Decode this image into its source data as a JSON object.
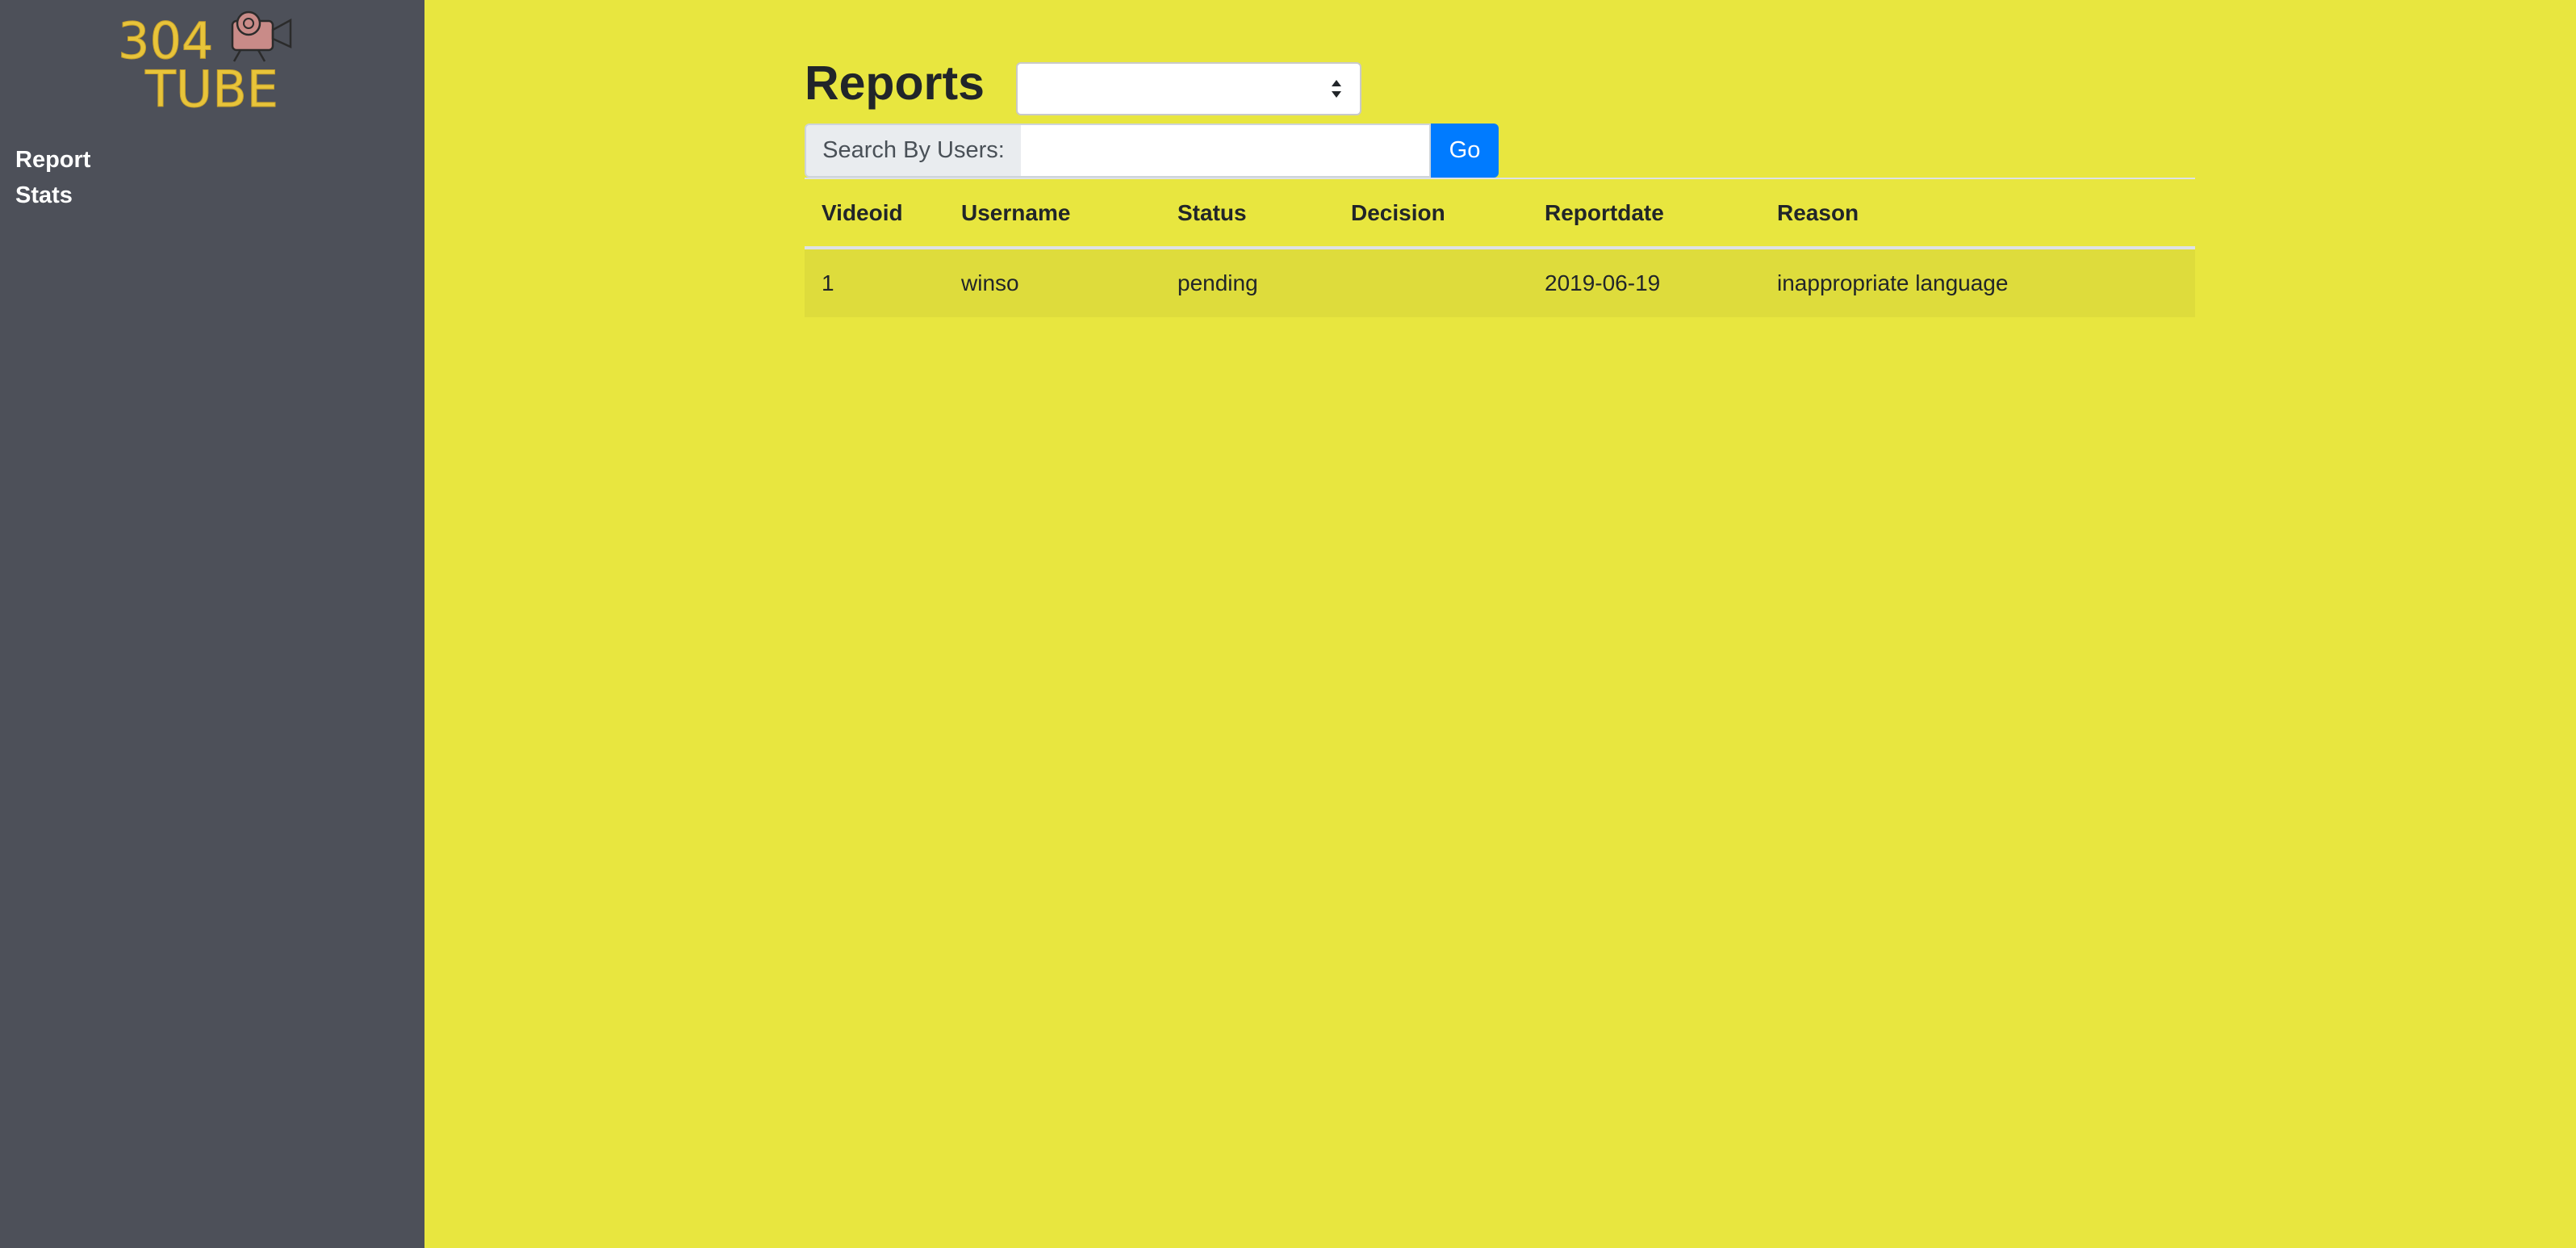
{
  "brand": {
    "logo_alt": "304 TUBE",
    "logo_text_top": "304",
    "logo_text_bottom": "TUBE"
  },
  "sidebar": {
    "items": [
      {
        "label": "Report"
      },
      {
        "label": "Stats"
      }
    ]
  },
  "main": {
    "title": "Reports",
    "filter_select": {
      "value": ""
    },
    "search": {
      "label": "Search By Users:",
      "value": "",
      "placeholder": "",
      "button_label": "Go"
    },
    "table": {
      "columns": [
        "Videoid",
        "Username",
        "Status",
        "Decision",
        "Reportdate",
        "Reason"
      ],
      "rows": [
        {
          "videoid": "1",
          "username": "winso",
          "status": "pending",
          "decision": "",
          "reportdate": "2019-06-19",
          "reason": "inappropriate language"
        }
      ]
    }
  },
  "colors": {
    "page_background": "#e8e63f",
    "sidebar_background": "#4d5059",
    "logo_text": "#e8c43a",
    "go_button": "#007bff",
    "striped_row": "#dfdd38"
  },
  "icons": {
    "logo_icon": "camera-icon",
    "select_arrow": "sort-arrows-icon"
  }
}
